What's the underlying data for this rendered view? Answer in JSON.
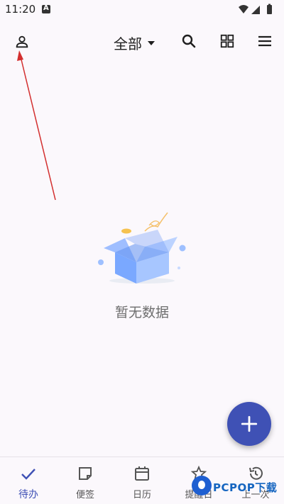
{
  "status_bar": {
    "time": "11:20"
  },
  "header": {
    "filter_label": "全部"
  },
  "empty_state": {
    "message": "暂无数据"
  },
  "bottom_nav": {
    "items": [
      {
        "label": "待办",
        "icon": "check-icon",
        "active": true
      },
      {
        "label": "便签",
        "icon": "note-icon",
        "active": false
      },
      {
        "label": "日历",
        "icon": "calendar-icon",
        "active": false
      },
      {
        "label": "提醒日",
        "icon": "star-icon",
        "active": false
      },
      {
        "label": "上一次",
        "icon": "history-icon",
        "active": false
      }
    ]
  },
  "watermark": {
    "text": "PCPOP下载"
  },
  "colors": {
    "accent": "#3f51b5",
    "background": "#fbf8fc",
    "annotation_arrow": "#d32f2f"
  }
}
